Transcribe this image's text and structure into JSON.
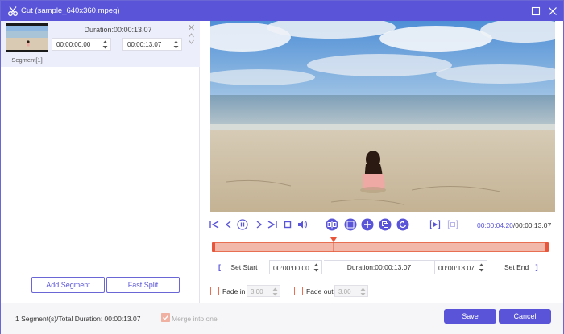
{
  "window": {
    "title": "Cut (sample_640x360.mpeg)"
  },
  "segment": {
    "label": "Segment[1]",
    "duration": "Duration:00:00:13.07",
    "start": "00:00:00.00",
    "end": "00:00:13.07"
  },
  "left_buttons": {
    "add": "Add Segment",
    "split": "Fast Split"
  },
  "player": {
    "current_time": "00:00:04.20",
    "total_time": "/00:00:13.07",
    "progress": 0.32
  },
  "set_row": {
    "set_start": "Set Start",
    "start_value": "00:00:00.00",
    "duration": "Duration:00:00:13.07",
    "end_value": "00:00:13.07",
    "set_end": "Set End",
    "bracket_open": "[",
    "bracket_close": "]"
  },
  "fade": {
    "fade_in_label": "Fade in",
    "fade_in_value": "3.00",
    "fade_out_label": "Fade out",
    "fade_out_value": "3.00"
  },
  "bottom": {
    "status": "1 Segment(s)/Total Duration: 00:00:13.07",
    "merge_label": "Merge into one",
    "save": "Save",
    "cancel": "Cancel"
  },
  "colors": {
    "accent": "#5a55d8",
    "timeline": "#e86f52",
    "timeline_fill": "#f2b9aa"
  }
}
